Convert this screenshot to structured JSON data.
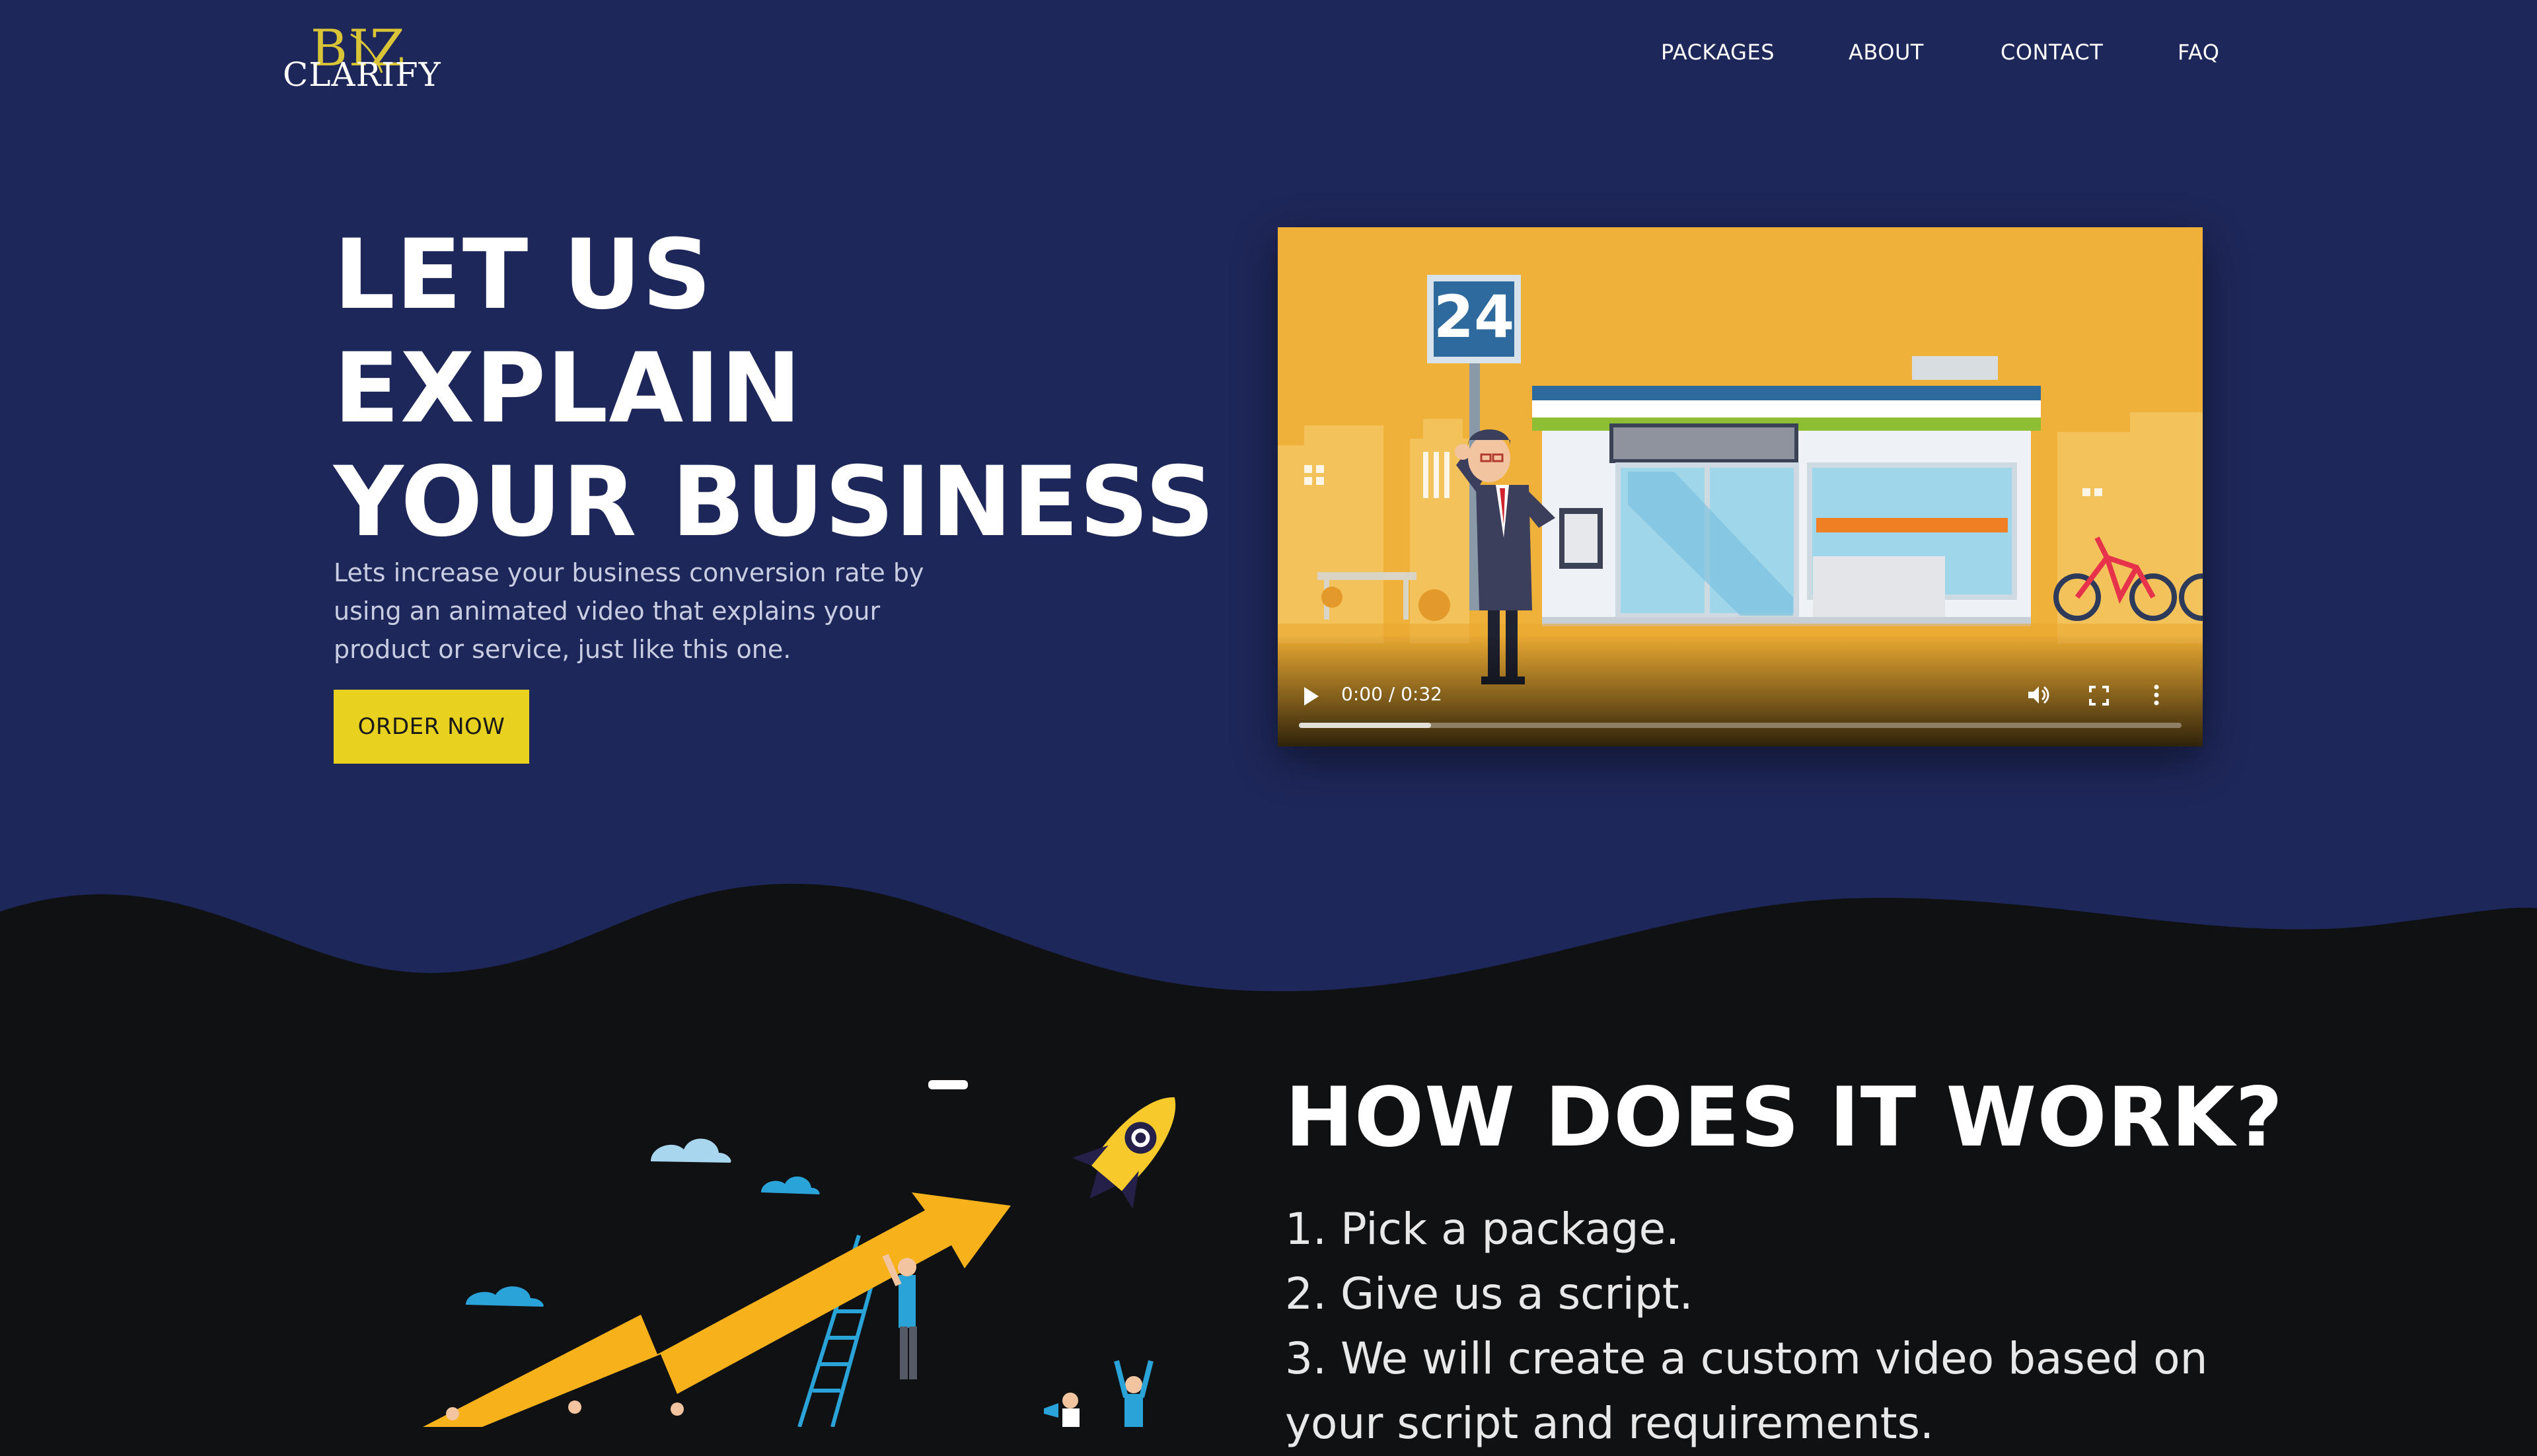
{
  "brand": {
    "logo_top": "BIZ",
    "logo_bottom": "CLARIFY"
  },
  "nav": {
    "items": [
      "PACKAGES",
      "ABOUT",
      "CONTACT",
      "FAQ"
    ]
  },
  "hero": {
    "headline": [
      "LET US",
      "EXPLAIN",
      "YOUR BUSINESS"
    ],
    "subtitle": [
      "Lets increase your business conversion rate by",
      "using an animated video that explains your",
      "product or service, just like this one."
    ],
    "cta": "ORDER NOW"
  },
  "video": {
    "sign_number": "24",
    "time": "0:00 / 0:32",
    "buffered_fraction": 0.15
  },
  "how": {
    "title": "HOW DOES IT WORK?",
    "steps": [
      "1. Pick a package.",
      "2. Give us a script.",
      "3. We will create a custom video based on",
      "your script and requirements."
    ]
  },
  "colors": {
    "hero_bg": "#1e2759",
    "page_bg": "#0f1113",
    "accent": "#e8d21f",
    "logo_gold": "#d9c438",
    "video_bg": "#f0b13a"
  },
  "icons": [
    "play-icon",
    "volume-icon",
    "fullscreen-icon",
    "more-vertical-icon",
    "rocket-icon",
    "cloud-icon"
  ]
}
